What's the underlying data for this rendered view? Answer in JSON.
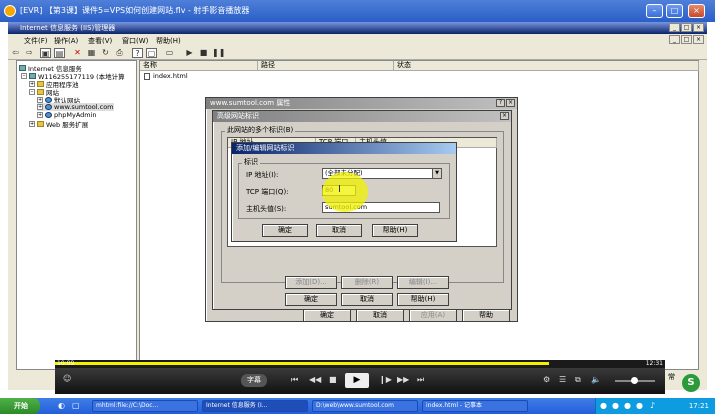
{
  "player": {
    "title": "[EVR] 【第3课】课件5=VPS如何创建网站.flv - 射手影音播放器"
  },
  "mmc": {
    "title": "Internet 信息服务 (IIS)管理器",
    "menu": [
      "文件(F)",
      "操作(A)",
      "查看(V)",
      "窗口(W)",
      "帮助(H)"
    ],
    "tree": [
      "Internet 信息服务",
      "W116255177119 (本地计算",
      "应用程序池",
      "网站",
      "默认网站",
      "www.sumtool.com",
      "phpMyAdmin",
      "Web 服务扩展"
    ],
    "columns": [
      "名称",
      "路径",
      "状态"
    ],
    "files": [
      "index.html"
    ]
  },
  "props_dialog": {
    "title": "www.sumtool.com 属性",
    "buttons": [
      "确定",
      "取消",
      "应用(A)",
      "帮助"
    ]
  },
  "adv_dialog": {
    "title": "高级网站标识",
    "group_label": "此网站的多个标识(B)",
    "columns": [
      "IP 地址",
      "TCP 端口",
      "主机头值"
    ],
    "buttons": [
      "添加(D)...",
      "删除(R)",
      "编辑(I)..."
    ],
    "bottom_buttons": [
      "确定",
      "取消",
      "帮助(H)"
    ]
  },
  "edit_dialog": {
    "title": "添加/编辑网站标识",
    "group_label": "标识",
    "ip_label": "IP 地址(I):",
    "ip_value": "(全部未分配)",
    "port_label": "TCP 端口(Q):",
    "port_value": "80",
    "host_label": "主机头值(S):",
    "host_value": "sumtool.com",
    "buttons": [
      "确定",
      "取消",
      "帮助(H)"
    ]
  },
  "video": {
    "time_current": "10:09",
    "time_total": "12:31",
    "progress": 0.81,
    "subtitle_label": "字幕",
    "cut_text": "常"
  },
  "taskbar": {
    "start": "开始",
    "tasks": [
      "mhtml:file://C:\\Doc...",
      "Internet 信息服务 (I...",
      "D:\\web\\www.sumtool.com",
      "index.html - 记事本"
    ],
    "clock": "17:21"
  },
  "colors": {
    "highlight": "#f2f200",
    "title_active": "#0a246a"
  }
}
